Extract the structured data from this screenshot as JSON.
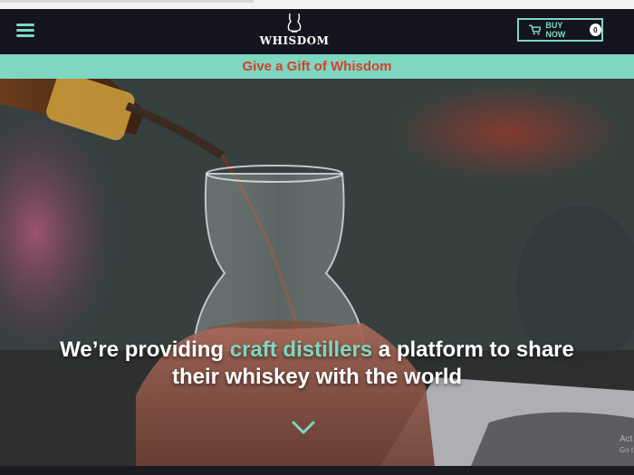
{
  "header": {
    "logo_text": "WHISDOM",
    "buy_label": "BUY NOW",
    "cart_count": "0"
  },
  "gift_banner": {
    "label": "Give a Gift of Whisdom"
  },
  "hero": {
    "headline_lead": "We’re providing ",
    "headline_accent": "craft distillers",
    "headline_rest_line1": " a platform to share",
    "headline_line2": "their whiskey with the world"
  },
  "watermark": {
    "line1": "Act",
    "line2": "Go t"
  },
  "colors": {
    "accent": "#7ed7c1",
    "header_bg": "#13141f",
    "gift_text": "#d6402a"
  },
  "icons": [
    "menu-icon",
    "glencairn-glass-icon",
    "cart-icon",
    "chevron-down-icon"
  ]
}
